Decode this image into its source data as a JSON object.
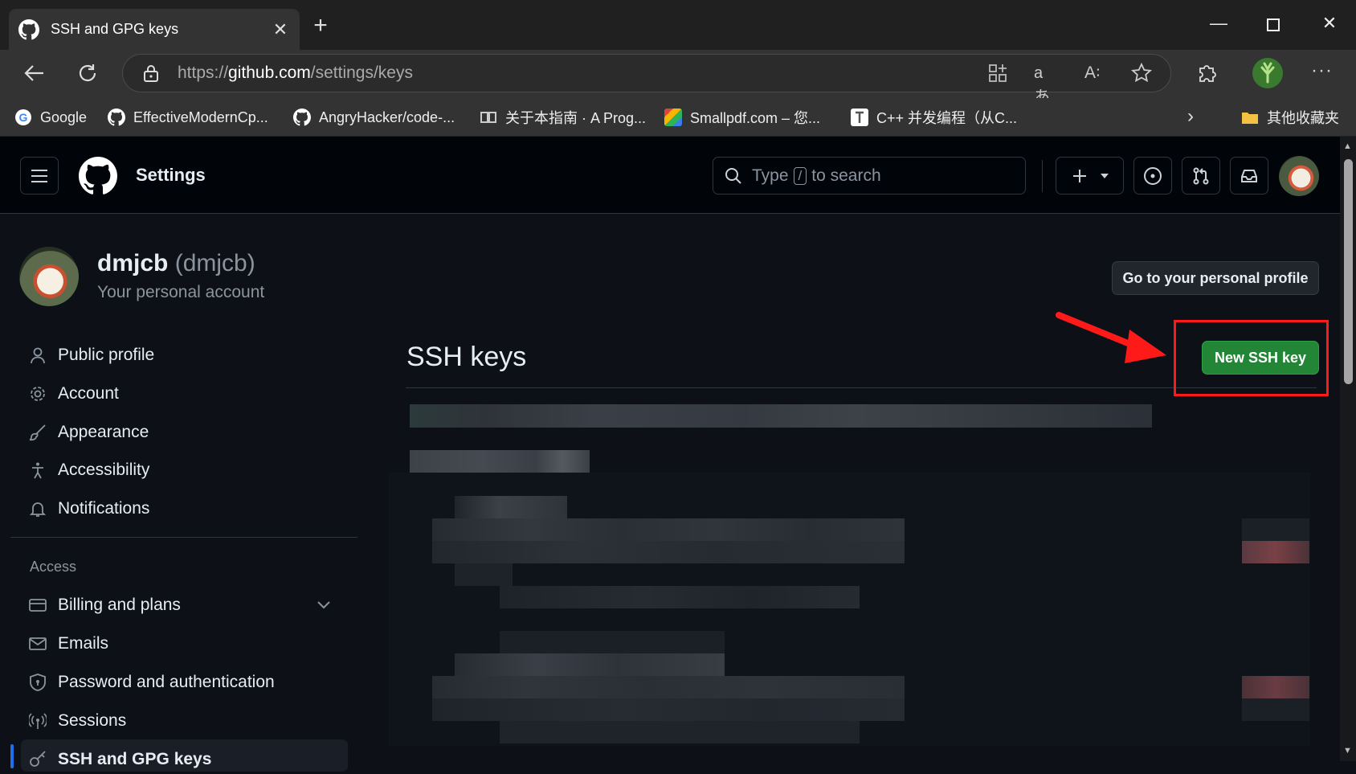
{
  "browser": {
    "tab_title": "SSH and GPG keys",
    "url_prefix": "https://",
    "url_host": "github.com",
    "url_path": "/settings/keys",
    "bookmarks": [
      {
        "label": "Google",
        "color": "#ffffff"
      },
      {
        "label": "EffectiveModernCp...",
        "color": "#ffffff"
      },
      {
        "label": "AngryHacker/code-...",
        "color": "#ffffff"
      },
      {
        "label": "关于本指南 · A Prog...",
        "color": "#cfcfcf"
      },
      {
        "label": "Smallpdf.com – 您...",
        "color": "#e0433e"
      },
      {
        "label": "C++ 并发编程（从C...",
        "color": "#ffffff"
      }
    ],
    "other_bookmarks": "其他收藏夹"
  },
  "header": {
    "title": "Settings",
    "search_type": "Type",
    "search_key": "/",
    "search_rest": "to search"
  },
  "profile": {
    "username": "dmjcb",
    "handle": "(dmjcb)",
    "subtitle": "Your personal account",
    "go_profile": "Go to your personal profile"
  },
  "sidebar": {
    "items": [
      {
        "label": "Public profile",
        "icon": "person-icon"
      },
      {
        "label": "Account",
        "icon": "gear-icon"
      },
      {
        "label": "Appearance",
        "icon": "paintbrush-icon"
      },
      {
        "label": "Accessibility",
        "icon": "accessibility-icon"
      },
      {
        "label": "Notifications",
        "icon": "bell-icon"
      }
    ],
    "section_access": "Access",
    "access_items": [
      {
        "label": "Billing and plans",
        "icon": "credit-card-icon"
      },
      {
        "label": "Emails",
        "icon": "mail-icon"
      },
      {
        "label": "Password and authentication",
        "icon": "shield-icon"
      },
      {
        "label": "Sessions",
        "icon": "broadcast-icon"
      },
      {
        "label": "SSH and GPG keys",
        "icon": "key-icon"
      }
    ]
  },
  "main": {
    "title": "SSH keys",
    "new_key_button": "New SSH key"
  },
  "colors": {
    "accent_green": "#238636",
    "annotation_red": "#ff1a1a",
    "active_blue": "#1f6feb"
  }
}
